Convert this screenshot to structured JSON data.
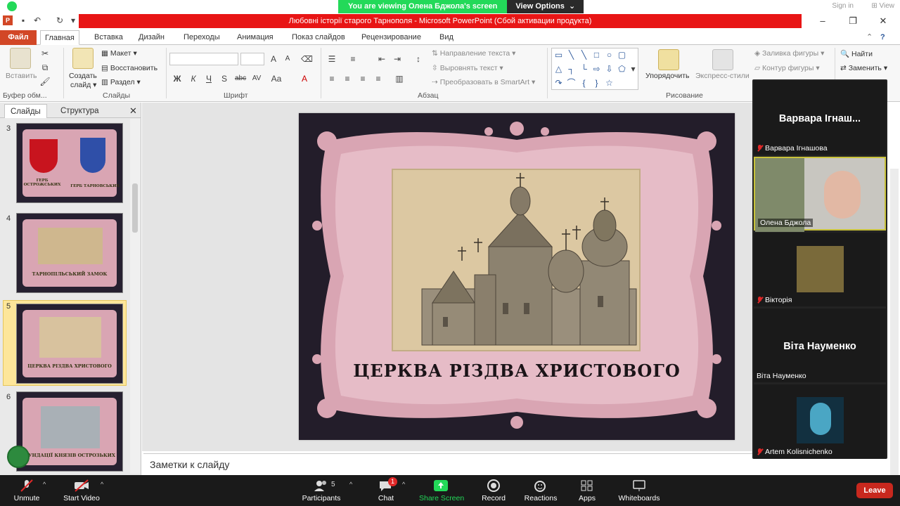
{
  "zoom": {
    "banner_text": "You are viewing Олена Бджола's screen",
    "view_options": "View Options",
    "sign_in": "Sign in",
    "view": "View",
    "toolbar": {
      "unmute": "Unmute",
      "start_video": "Start Video",
      "participants": "Participants",
      "participants_count": "5",
      "chat": "Chat",
      "chat_badge": "1",
      "share_screen": "Share Screen",
      "record": "Record",
      "reactions": "Reactions",
      "apps": "Apps",
      "whiteboards": "Whiteboards",
      "leave": "Leave"
    },
    "participants_panel": [
      {
        "big_name": "Варвара Ігнаш...",
        "label": "Варвара Ігнашова",
        "video": false,
        "muted": true
      },
      {
        "big_name": "",
        "label": "Олена Бджола",
        "video": true,
        "muted": false
      },
      {
        "big_name": "",
        "label": "Вікторія",
        "video": true,
        "muted": true
      },
      {
        "big_name": "Віта Науменко",
        "label": "Віта Науменко",
        "video": false,
        "muted": false
      },
      {
        "big_name": "",
        "label": "Artem Kolisnichenko",
        "video": true,
        "muted": true
      }
    ]
  },
  "powerpoint": {
    "title": "Любовні історії старого Тарнополя  -  Microsoft PowerPoint (Сбой активации продукта)",
    "tabs": [
      "Файл",
      "Главная",
      "Вставка",
      "Дизайн",
      "Переходы",
      "Анимация",
      "Показ слайдов",
      "Рецензирование",
      "Вид"
    ],
    "active_tab": "Главная",
    "ribbon": {
      "clipboard": {
        "paste": "Вставить",
        "label": "Буфер обм..."
      },
      "slides": {
        "new_slide_line1": "Создать",
        "new_slide_line2": "слайд",
        "layout": "Макет",
        "reset": "Восстановить",
        "section": "Раздел",
        "label": "Слайды"
      },
      "font": {
        "label": "Шрифт"
      },
      "paragraph": {
        "text_direction": "Направление текста",
        "align_text": "Выровнять текст",
        "smartart": "Преобразовать в SmartArt",
        "label": "Абзац"
      },
      "drawing": {
        "arrange": "Упорядочить",
        "quick_styles": "Экспресс-стили",
        "shape_fill": "Заливка фигуры",
        "shape_outline": "Контур фигуры",
        "label": "Рисование"
      },
      "editing": {
        "find": "Найти",
        "replace": "Заменить"
      }
    },
    "pane_tabs": [
      "Слайды",
      "Структура"
    ],
    "slides": [
      {
        "number": "3",
        "caption_left": "ГЕРБ ОСТРОЖСЬКИХ",
        "caption_right": "ГЕРБ ТАРНОВСЬКИХ"
      },
      {
        "number": "4",
        "caption": "ТАРНОПІЛЬСЬКИЙ ЗАМОК"
      },
      {
        "number": "5",
        "caption": "ЦЕРКВА РІЗДВА ХРИСТОВОГО"
      },
      {
        "number": "6",
        "caption": "ФУНДАЦІЇ КНЯЗІВ ОСТРОЗЬКИХ"
      }
    ],
    "selected_slide": "5",
    "current_slide_title": "ЦЕРКВА РІЗДВА ХРИСТОВОГО",
    "notes_placeholder": "Заметки к слайду"
  },
  "colors": {
    "zoom_green": "#23d959",
    "title_red": "#e81515",
    "file_tab": "#d24726",
    "slide_bg": "#231d2a",
    "frame_pink": "#d9a5b3",
    "leave_red": "#c8281e"
  }
}
